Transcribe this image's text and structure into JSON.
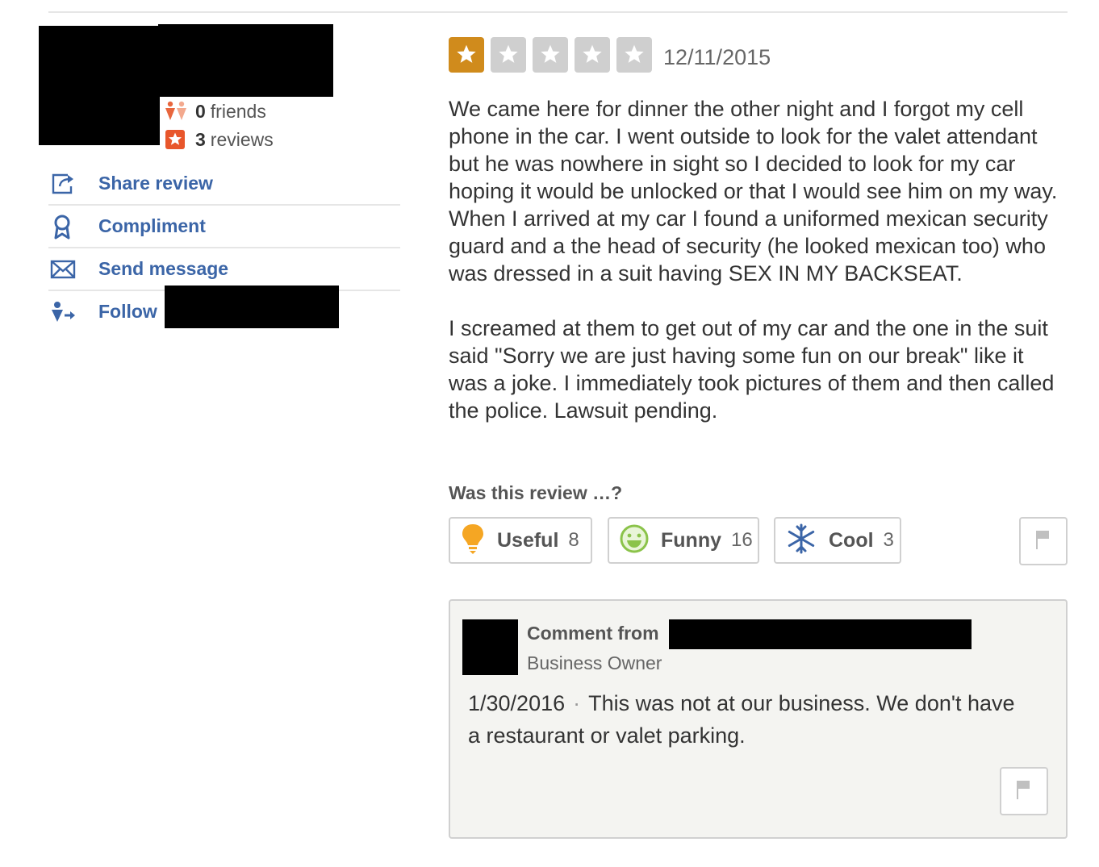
{
  "user": {
    "friends_count": "0",
    "friends_label": "friends",
    "reviews_count": "3",
    "reviews_label": "reviews"
  },
  "actions": [
    {
      "label": "Share review",
      "icon": "share-icon"
    },
    {
      "label": "Compliment",
      "icon": "award-icon"
    },
    {
      "label": "Send message",
      "icon": "envelope-icon"
    },
    {
      "label": "Follow",
      "icon": "follow-user-icon"
    }
  ],
  "review": {
    "rating": 1,
    "max_rating": 5,
    "date": "12/11/2015",
    "paragraphs": [
      "We came here for dinner the other night and I forgot my cell phone in the car. I went outside to look for the valet attendant but he was nowhere in sight so I decided to look for my car hoping it would be unlocked or that I would see him on my way. When I arrived at my car I found a uniformed mexican security guard and a the head of security (he looked mexican too) who was dressed in a suit having SEX IN MY BACKSEAT.",
      "I screamed at them to get out of my car and the one in the suit said \"Sorry we are just having some fun on our break\" like it was a joke. I immediately took pictures of them and then called the police. Lawsuit pending."
    ]
  },
  "votes": {
    "prompt": "Was this review …?",
    "useful": {
      "label": "Useful",
      "count": "8"
    },
    "funny": {
      "label": "Funny",
      "count": "16"
    },
    "cool": {
      "label": "Cool",
      "count": "3"
    }
  },
  "comment": {
    "from_label": "Comment from",
    "role": "Business Owner",
    "date": "1/30/2016",
    "separator": "·",
    "text": "This was not at our business.  We don't have a restaurant or valet parking."
  },
  "colors": {
    "link": "#3b65a7",
    "star_on": "#d08b1c",
    "star_off": "#cfcfcf",
    "useful_icon": "#f5a623",
    "funny_icon": "#8bc34a",
    "cool_icon": "#3b65a7"
  }
}
